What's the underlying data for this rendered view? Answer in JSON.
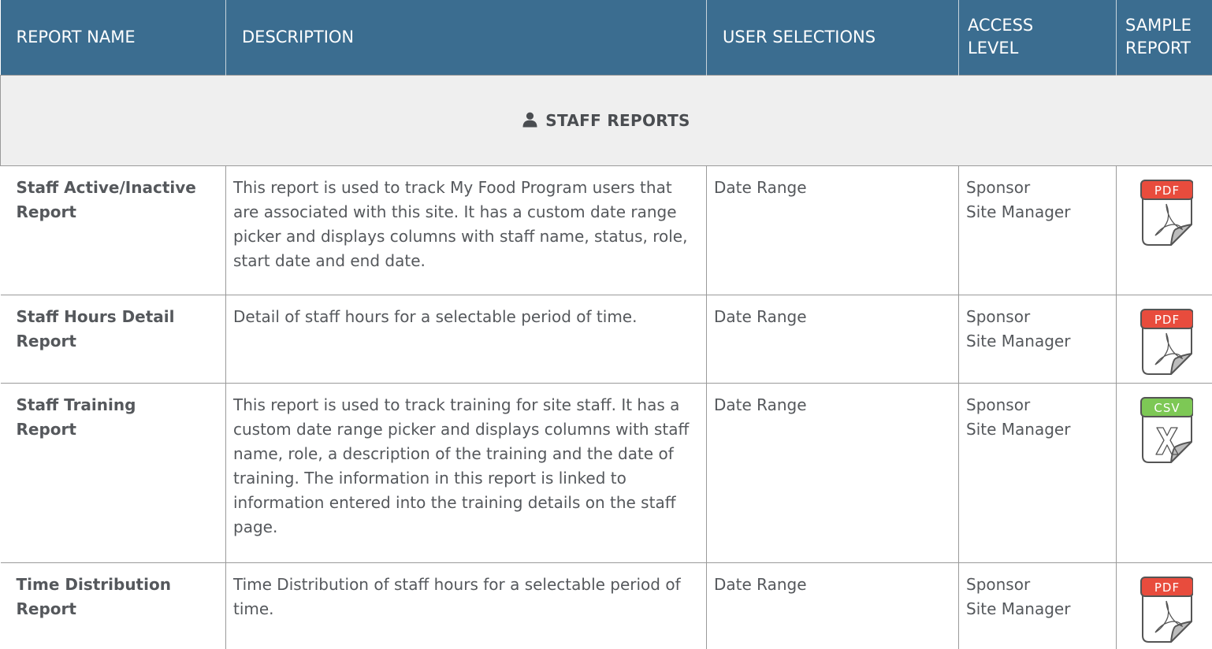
{
  "columns": {
    "name": "REPORT NAME",
    "description": "DESCRIPTION",
    "user_selections": "USER SELECTIONS",
    "access_level_line1": "ACCESS",
    "access_level_line2": "LEVEL",
    "sample_line1": "SAMPLE",
    "sample_line2": "REPORT"
  },
  "section": {
    "title": "STAFF REPORTS",
    "icon": "person-icon"
  },
  "reports": [
    {
      "name_line1": "Staff Active/Inactive",
      "name_line2": "Report",
      "description": "This report is used to track My Food Program users that are associated with this site. It has a custom date range picker and displays columns with staff name, status, role, start date and end date.",
      "user_selections": "Date Range",
      "access_line1": "Sponsor",
      "access_line2": "Site Manager",
      "sample_type": "PDF",
      "sample_color": "#e84c3d"
    },
    {
      "name_line1": "Staff Hours Detail",
      "name_line2": "Report",
      "description": "Detail of staff hours for a selectable period of time.",
      "user_selections": "Date Range",
      "access_line1": "Sponsor",
      "access_line2": "Site Manager",
      "sample_type": "PDF",
      "sample_color": "#e84c3d"
    },
    {
      "name_line1": "Staff Training",
      "name_line2": "Report",
      "description": "This report is used to track training for site staff. It has a custom date range picker and displays columns with staff name, role, a description of the training and the date of training. The information in this report is linked to information entered into the training details on the staff page.",
      "user_selections": "Date Range",
      "access_line1": "Sponsor",
      "access_line2": "Site Manager",
      "sample_type": "CSV",
      "sample_color": "#7dc855"
    },
    {
      "name_line1": "Time Distribution",
      "name_line2": "Report",
      "description": "Time Distribution of staff hours for a selectable period of time.",
      "user_selections": "Date Range",
      "access_line1": "Sponsor",
      "access_line2": "Site Manager",
      "sample_type": "PDF",
      "sample_color": "#e84c3d"
    }
  ]
}
